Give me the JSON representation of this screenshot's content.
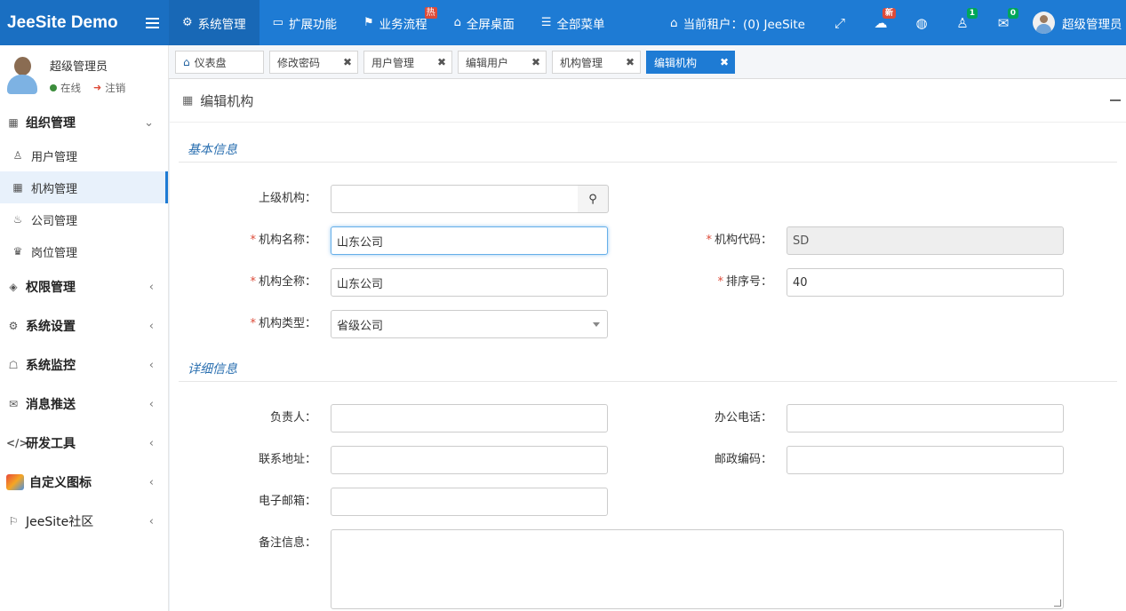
{
  "app": {
    "title": "JeeSite Demo"
  },
  "topnav": {
    "items": [
      {
        "label": "系统管理",
        "icon": "gear-icon"
      },
      {
        "label": "扩展功能",
        "icon": "monitor-icon"
      },
      {
        "label": "业务流程",
        "icon": "flag-icon",
        "badge": "热"
      },
      {
        "label": "全屏桌面",
        "icon": "home-icon"
      },
      {
        "label": "全部菜单",
        "icon": "menu-icon"
      }
    ],
    "tenant": "当前租户：(0) JeeSite",
    "badges": {
      "new": "新",
      "users": "1",
      "messages": "0"
    },
    "user": "超级管理员"
  },
  "sidebar": {
    "user_name": "超级管理员",
    "status_online": "在线",
    "status_logout": "注销",
    "groups": [
      {
        "label": "组织管理",
        "items": [
          "用户管理",
          "机构管理",
          "公司管理",
          "岗位管理"
        ]
      },
      {
        "label": "权限管理"
      },
      {
        "label": "系统设置"
      },
      {
        "label": "系统监控"
      },
      {
        "label": "消息推送"
      },
      {
        "label": "研发工具"
      },
      {
        "label": "自定义图标"
      },
      {
        "label": "JeeSite社区"
      }
    ]
  },
  "tabs": [
    "仪表盘",
    "修改密码",
    "用户管理",
    "编辑用户",
    "机构管理",
    "编辑机构"
  ],
  "form": {
    "title": "编辑机构",
    "section_basic": "基本信息",
    "section_detail": "详细信息",
    "parent_label": "上级机构：",
    "parent_value": "",
    "name_label": "机构名称：",
    "name_value": "山东公司",
    "code_label": "机构代码：",
    "code_value": "SD",
    "fullname_label": "机构全称：",
    "fullname_value": "山东公司",
    "sort_label": "排序号：",
    "sort_value": "40",
    "type_label": "机构类型：",
    "type_value": "省级公司",
    "leader_label": "负责人：",
    "phone_label": "办公电话：",
    "address_label": "联系地址：",
    "zip_label": "邮政编码：",
    "email_label": "电子邮箱：",
    "remarks_label": "备注信息："
  },
  "colors": {
    "primary": "#1e7bd4",
    "required": "#dd4b39",
    "section": "#2a6fb0"
  }
}
